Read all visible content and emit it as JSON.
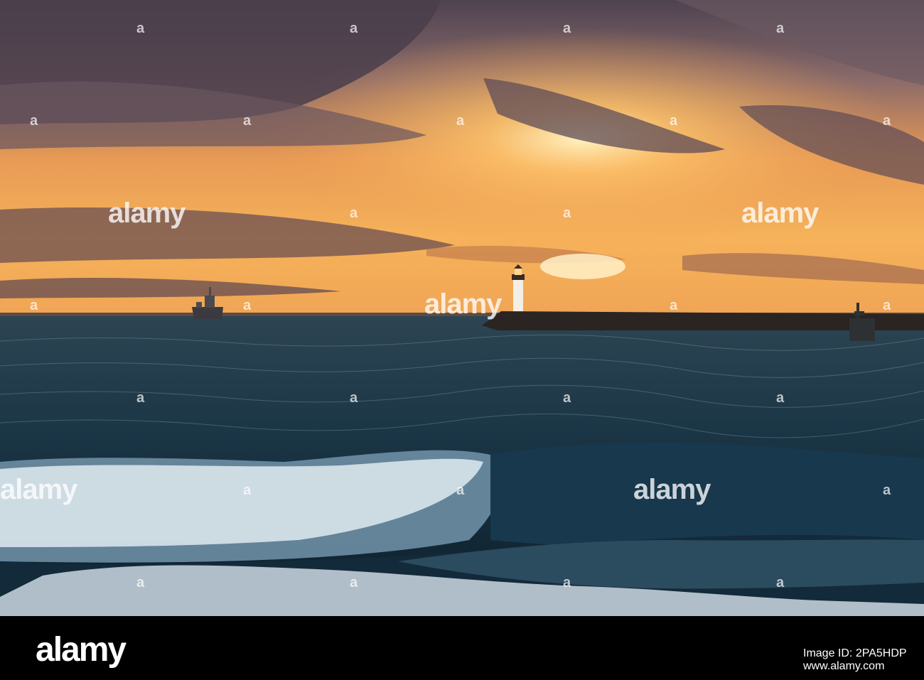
{
  "photo": {
    "watermark_text": "alamy",
    "watermark_dot": "a",
    "colors": {
      "sky_top": "#5b4a55",
      "sky_glow": "#f3a24a",
      "sun": "#ffe6a0",
      "sea": "#1c3848",
      "sea_deep": "#0f2230",
      "foam": "#e8f1f6",
      "pier": "#2a2522",
      "lighthouse": "#f4efe6"
    }
  },
  "footer": {
    "logo": "alamy",
    "image_id_label": "Image ID:",
    "image_id": "2PA5HDP",
    "website": "www.alamy.com"
  }
}
